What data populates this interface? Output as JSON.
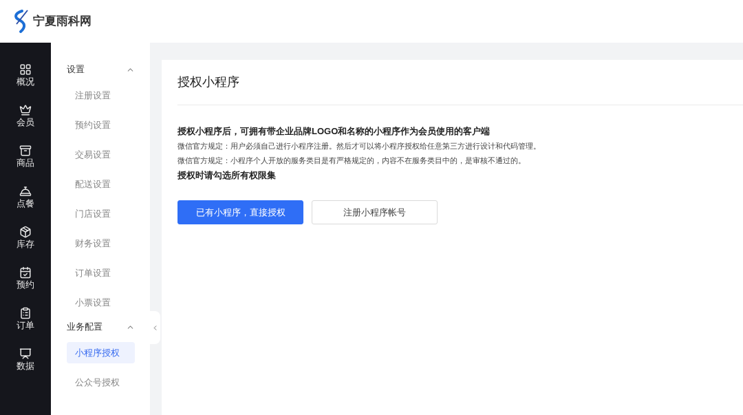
{
  "header": {
    "brand": "宁夏雨科网"
  },
  "nav_rail": [
    {
      "label": "概况"
    },
    {
      "label": "会员"
    },
    {
      "label": "商品"
    },
    {
      "label": "点餐"
    },
    {
      "label": "库存"
    },
    {
      "label": "预约"
    },
    {
      "label": "订单"
    },
    {
      "label": "数据"
    }
  ],
  "submenu": [
    {
      "title": "设置",
      "expanded": true,
      "items": [
        {
          "label": "注册设置",
          "selected": false
        },
        {
          "label": "预约设置",
          "selected": false
        },
        {
          "label": "交易设置",
          "selected": false
        },
        {
          "label": "配送设置",
          "selected": false
        },
        {
          "label": "门店设置",
          "selected": false
        },
        {
          "label": "财务设置",
          "selected": false
        },
        {
          "label": "订单设置",
          "selected": false
        },
        {
          "label": "小票设置",
          "selected": false
        }
      ]
    },
    {
      "title": "业务配置",
      "expanded": true,
      "items": [
        {
          "label": "小程序授权",
          "selected": true
        },
        {
          "label": "公众号授权",
          "selected": false
        }
      ]
    }
  ],
  "page": {
    "title": "授权小程序",
    "lines": [
      {
        "kind": "strong",
        "text": "授权小程序后，可拥有带企业品牌LOGO和名称的小程序作为会员使用的客户端"
      },
      {
        "kind": "note",
        "text": "微信官方规定：用户必须自己进行小程序注册。然后才可以将小程序授权给任意第三方进行设计和代码管理。"
      },
      {
        "kind": "note",
        "text": "微信官方规定：小程序个人开放的服务类目是有严格规定的，内容不在服务类目中的，是审核不通过的。"
      },
      {
        "kind": "strong",
        "text": "授权时请勾选所有权限集"
      }
    ],
    "buttons": [
      {
        "label": "已有小程序，直接授权",
        "kind": "primary"
      },
      {
        "label": "注册小程序帐号",
        "kind": "default"
      }
    ]
  }
}
